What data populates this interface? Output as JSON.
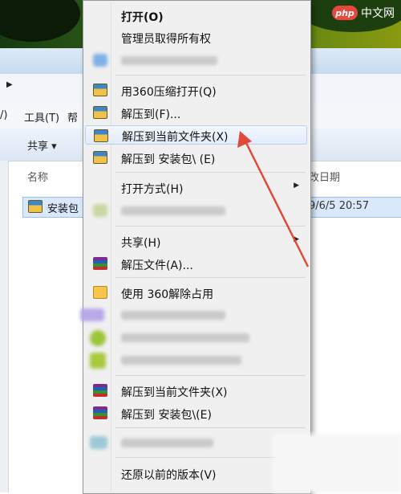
{
  "watermark": {
    "logo": "php",
    "text": "中文网"
  },
  "explorer": {
    "menu": {
      "item_left_fragment": "/)",
      "tools": "工具(T)",
      "help_fragment": "帮"
    },
    "toolbar": {
      "share": "共享 ▾"
    },
    "columns": {
      "name": "名称",
      "date": "改日期"
    },
    "file": {
      "name": "安装包",
      "date": "9/6/5 20:57"
    }
  },
  "context_menu": {
    "items": [
      {
        "label": "打开(O)",
        "bold": true
      },
      {
        "label": "管理员取得所有权"
      },
      {
        "label": "用360压缩打开(Q)",
        "icon": "360-archive-icon"
      },
      {
        "label": "解压到(F)...",
        "icon": "360-archive-icon"
      },
      {
        "label": "解压到当前文件夹(X)",
        "icon": "360-archive-icon",
        "highlighted": true
      },
      {
        "label": "解压到 安装包\\ (E)",
        "icon": "360-archive-icon"
      },
      {
        "label": "打开方式(H)",
        "submenu": true
      },
      {
        "label": "共享(H)",
        "submenu": true
      },
      {
        "label": "解压文件(A)...",
        "icon": "winrar-icon"
      },
      {
        "label": "使用 360解除占用",
        "icon": "unlock-icon"
      },
      {
        "label": "解压到当前文件夹(X)",
        "icon": "winrar-icon"
      },
      {
        "label": "解压到 安装包\\(E)",
        "icon": "winrar-icon"
      },
      {
        "label": "还原以前的版本(V)"
      }
    ]
  },
  "colors": {
    "annotation_arrow": "#e04a3a",
    "menu_bg": "#f0f0f0",
    "highlight_border": "#b8d0f0"
  }
}
